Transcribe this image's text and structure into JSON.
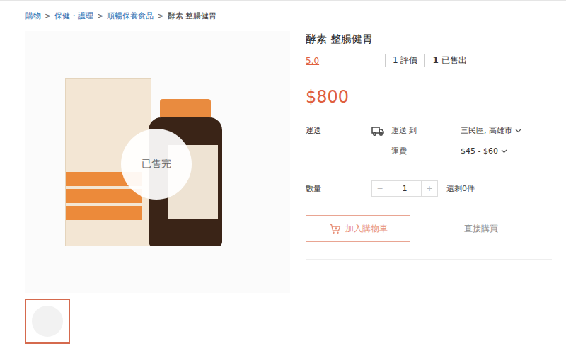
{
  "breadcrumb": [
    "購物",
    "保健・護理",
    "順暢保養食品",
    "酵素 整腸健胃"
  ],
  "breadcrumb_separator": ">",
  "gallery": {
    "overlay": "已售完",
    "thumbnails": [
      {
        "selected": true
      }
    ]
  },
  "product": {
    "title": "酵素 整腸健胃",
    "rating": "5.0",
    "reviews": {
      "count": "1",
      "label": "評價"
    },
    "sold": {
      "count": "1",
      "label": "已售出"
    },
    "price": "$800"
  },
  "shipping": {
    "label": "運送",
    "to_label": "運送 到",
    "destination": "三民區, 高雄市",
    "fee_label": "運費",
    "fee": "$45 - $60"
  },
  "quantity": {
    "label": "數量",
    "minus": "−",
    "value": "1",
    "plus": "+",
    "stock": "還剩0件",
    "disabled": true
  },
  "buttons": [
    {
      "label": "加入購物車",
      "kind": "cart",
      "disabled": true
    },
    {
      "label": "直接購買",
      "kind": "buy",
      "disabled": true
    }
  ]
}
